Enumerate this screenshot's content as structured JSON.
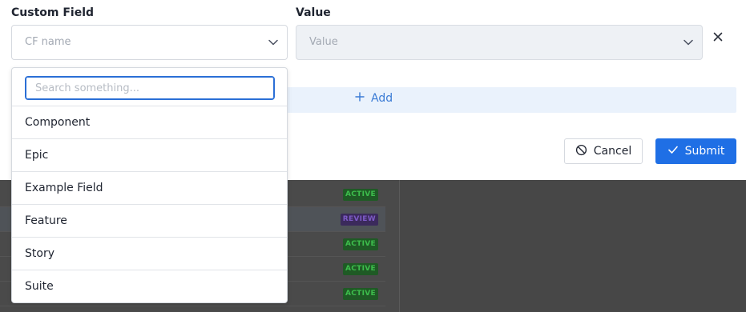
{
  "form": {
    "custom_field_label": "Custom Field",
    "value_label": "Value",
    "cf_placeholder": "CF name",
    "value_placeholder": "Value",
    "add_label": "Add",
    "cancel_label": "Cancel",
    "submit_label": "Submit"
  },
  "dropdown": {
    "search_placeholder": "Search something...",
    "options": [
      "Component",
      "Epic",
      "Example Field",
      "Feature",
      "Story",
      "Suite"
    ]
  },
  "background": {
    "badges": [
      "ACTIVE",
      "REVIEW",
      "ACTIVE",
      "ACTIVE",
      "ACTIVE"
    ]
  },
  "colors": {
    "primary": "#1f6fe5",
    "add_bar": "#eaf2fc",
    "active_badge": "#3dbd4c",
    "review_badge": "#7e5bc7"
  },
  "icons": {
    "chevron": "chevron-down-icon",
    "close": "close-icon",
    "plus": "plus-icon",
    "cancel": "ban-icon",
    "submit": "check-icon"
  }
}
